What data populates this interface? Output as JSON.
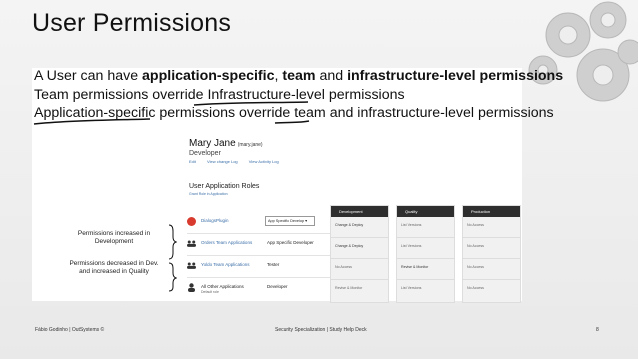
{
  "slide": {
    "title": "User Permissions"
  },
  "intro": {
    "line1_pre": "A User can have ",
    "line1_b1": "application-specific",
    "line1_mid1": ", ",
    "line1_b2": "team",
    "line1_mid2": " and ",
    "line1_b3": "infrastructure-level permissions",
    "line2": "Team permissions override Infrastructure-level permissions",
    "line3": "Application-specific permissions override team and infrastructure-level permissions"
  },
  "user": {
    "name": "Mary Jane",
    "username": "(mary.jane)",
    "role": "Developer",
    "link_edit": "Edit",
    "link_change": "View change Log",
    "link_activity": "View Activity Log"
  },
  "roles": {
    "title": "User Application Roles",
    "subtitle": "Grant Role in Application",
    "apps": [
      {
        "name": "DialogsPlugin",
        "role": "App Specific Develop ▾",
        "icon_color": "#d83b2e"
      },
      {
        "name": "Orders Team Applications",
        "role": "App Specific Developer",
        "icon_color": "#333333"
      },
      {
        "name": "Yoldo Team Applications",
        "role": "Tester",
        "icon_color": "#333333"
      },
      {
        "name": "All Other Applications",
        "sub": "Default role",
        "role": "Developer",
        "icon_color": "#333333"
      }
    ]
  },
  "environments": [
    {
      "name": "Development",
      "cells": [
        "Change & Deploy",
        "Change & Deploy",
        "No Access",
        "Revise & Monitor"
      ]
    },
    {
      "name": "Quality",
      "cells": [
        "List Versions",
        "List Versions",
        "Revise & Monitor",
        "List Versions"
      ]
    },
    {
      "name": "Production",
      "cells": [
        "No Access",
        "No Access",
        "No Access",
        "No Access"
      ]
    }
  ],
  "annotations": {
    "increased": "Permissions increased in Development",
    "decreased": "Permissions decreased in Dev. and increased in Quality"
  },
  "footer": {
    "left": "Fábio Godinho | OutSystems ©",
    "middle": "Security Specialization | Study Help Deck",
    "page": "8"
  }
}
